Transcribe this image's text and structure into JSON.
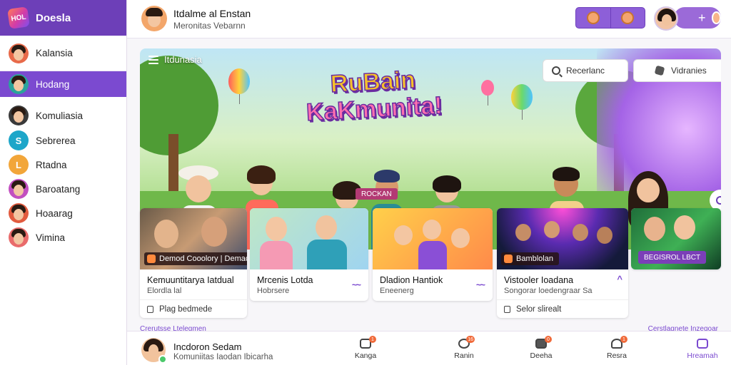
{
  "app": {
    "name": "Doesla",
    "logo_text": "HOL"
  },
  "sidebar": {
    "items": [
      {
        "label": "Kalansia",
        "color": "#e86a4a"
      },
      {
        "label": "Hodang",
        "color": "#2aa39a"
      },
      {
        "label": "Komuliasia",
        "color": "#3a3a3a"
      },
      {
        "label": "Sebrerea",
        "color": "#1da6c9",
        "initial": "S"
      },
      {
        "label": "Rtadna",
        "color": "#f2a63a",
        "initial": "L"
      },
      {
        "label": "Baroatang",
        "color": "#c24fc0"
      },
      {
        "label": "Hoaarag",
        "color": "#e25b3f"
      },
      {
        "label": "Vimina",
        "color": "#e96b6b"
      }
    ],
    "active_index": 1
  },
  "header": {
    "title": "Itdalme al Enstan",
    "subtitle": "Meronitas Vebarnn",
    "add_symbol": "+"
  },
  "banner": {
    "label": "Itdunasia",
    "title_line1": "RuBain",
    "title_line2": "KaKmunita!",
    "badge": "ROCKAN",
    "search_placeholder": "Recerlanc",
    "videos_label": "Vidranies"
  },
  "cards": [
    {
      "tag": "Demod Cooolory | Demact",
      "title": "Kemuuntitarya Iatdual",
      "subtitle": "Elordla lal",
      "footer": "Plag bedmede"
    },
    {
      "title": "Mrcenis Lotda",
      "subtitle": "Hobrsere",
      "wave": "~~"
    },
    {
      "title": "Dladion Hantiok",
      "subtitle": "Eneenerg",
      "wave": "~~"
    },
    {
      "tag": "Bamblolan",
      "title": "Vistooler Ioadana",
      "subtitle": "Songorar loedengraar Sa",
      "footer": "Selor slirealt",
      "wave": "^"
    },
    {
      "tag": "BEGISROL LBCT"
    }
  ],
  "footer_links": {
    "left": "Crerutsse Ltelegmen",
    "right": "Cerstlagnete Inzegoar"
  },
  "bottom_bar": {
    "title": "Incdoron Sedam",
    "subtitle": "Komuniitas Iaodan Ibicarha",
    "tabs": [
      {
        "label": "Kanga",
        "badge": "1"
      },
      {
        "label": "Ranin",
        "badge": "16"
      },
      {
        "label": "Deeha",
        "badge": "0"
      },
      {
        "label": "Resra",
        "badge": "1"
      },
      {
        "label": "Hreamah",
        "badge": ""
      }
    ],
    "active_tab": 4
  },
  "colors": {
    "accent": "#7b4ad0",
    "brand": "#6d3fb8",
    "badge": "#f06a3a"
  }
}
